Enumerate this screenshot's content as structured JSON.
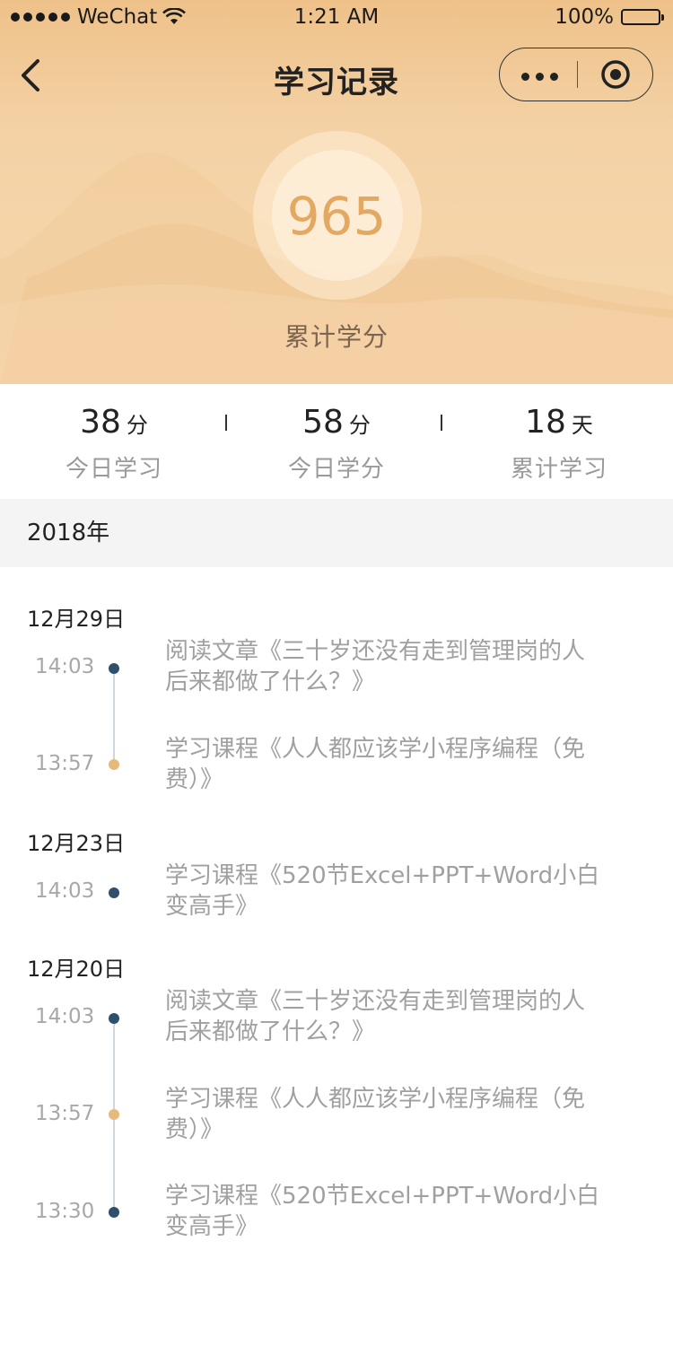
{
  "status_bar": {
    "carrier": "WeChat",
    "time": "1:21 AM",
    "battery": "100%"
  },
  "nav": {
    "title": "学习记录"
  },
  "score": {
    "value": "965",
    "label": "累计学分"
  },
  "stats": [
    {
      "value": "38",
      "unit": "分",
      "label": "今日学习"
    },
    {
      "value": "58",
      "unit": "分",
      "label": "今日学分"
    },
    {
      "value": "18",
      "unit": "天",
      "label": "累计学习"
    }
  ],
  "year": "2018年",
  "days": [
    {
      "date": "12月29日",
      "entries": [
        {
          "time": "14:03",
          "line1": "阅读文章《三十岁还没有走到管理岗的人",
          "line2": "后来都做了什么？》",
          "dot": "dark"
        },
        {
          "time": "13:57",
          "line1": "学习课程《人人都应该学小程序编程（免",
          "line2": "费）》",
          "dot": "gold"
        }
      ]
    },
    {
      "date": "12月23日",
      "entries": [
        {
          "time": "14:03",
          "line1": "学习课程《520节Excel+PPT+Word小白",
          "line2": "变高手》",
          "dot": "dark"
        }
      ]
    },
    {
      "date": "12月20日",
      "entries": [
        {
          "time": "14:03",
          "line1": "阅读文章《三十岁还没有走到管理岗的人",
          "line2": "后来都做了什么？》",
          "dot": "dark"
        },
        {
          "time": "13:57",
          "line1": "学习课程《人人都应该学小程序编程（免",
          "line2": "费）》",
          "dot": "gold"
        },
        {
          "time": "13:30",
          "line1": "学习课程《520节Excel+PPT+Word小白",
          "line2": "变高手》",
          "dot": "dark"
        }
      ]
    }
  ],
  "colors": {
    "accent_gold": "#e3a862",
    "dot_dark": "#2f4f6b",
    "dot_gold": "#e8b978"
  }
}
